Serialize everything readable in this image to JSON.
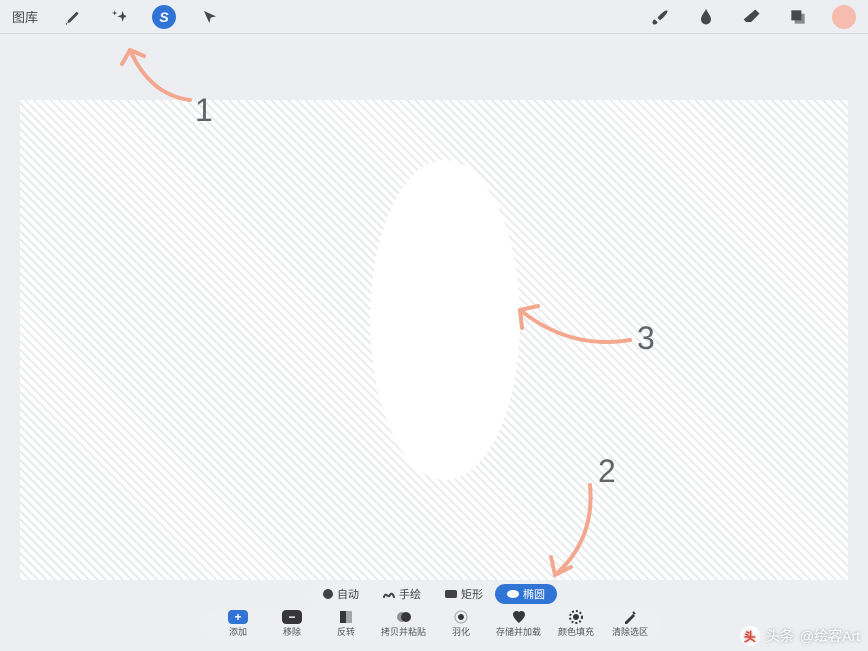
{
  "topbar": {
    "gallery_label": "图库",
    "selection_glyph": "S"
  },
  "annotations": {
    "n1": "1",
    "n2": "2",
    "n3": "3"
  },
  "selmodes": {
    "auto": "自动",
    "freehand": "手绘",
    "rect": "矩形",
    "ellipse": "椭圆"
  },
  "actions": {
    "add": {
      "label": "添加",
      "glyph": "+"
    },
    "remove": {
      "label": "移除",
      "glyph": "−"
    },
    "invert": {
      "label": "反转"
    },
    "copypaste": {
      "label": "拷贝并粘贴"
    },
    "feather": {
      "label": "羽化"
    },
    "saveload": {
      "label": "存储并加载"
    },
    "colorfill": {
      "label": "颜色填充"
    },
    "clear": {
      "label": "清除选区"
    }
  },
  "watermark": {
    "prefix": "头条",
    "handle": "@绘客Art",
    "logo_glyph": "头"
  }
}
